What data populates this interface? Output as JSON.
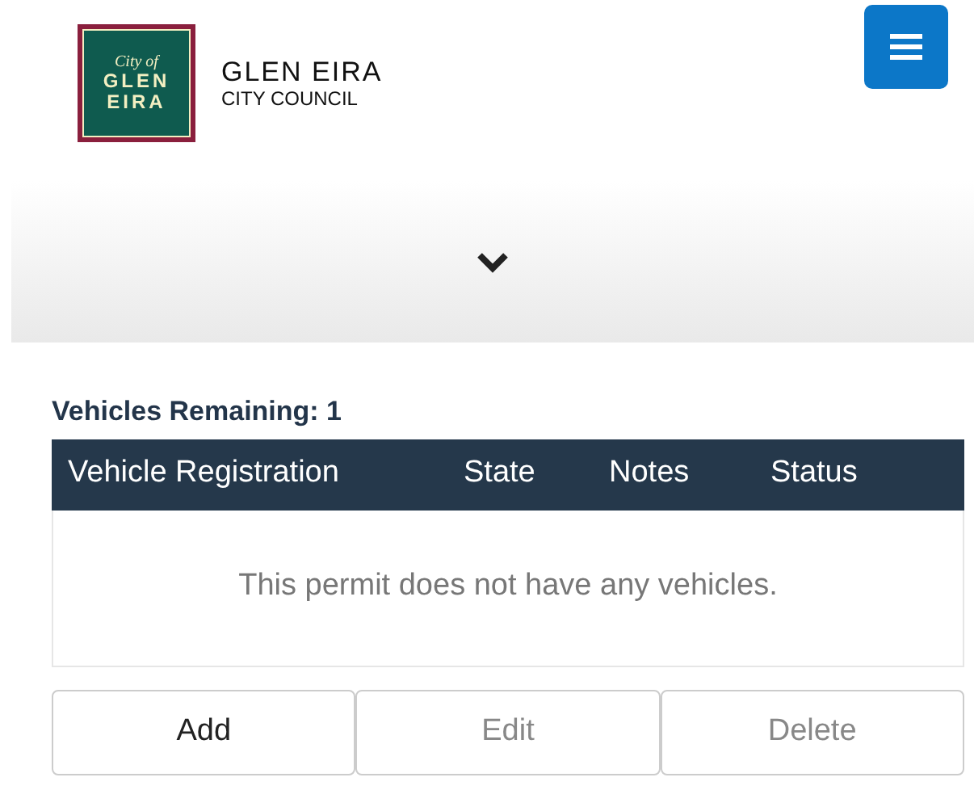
{
  "header": {
    "logo": {
      "line_1": "City of",
      "line_2": "GLEN",
      "line_3": "EIRA"
    },
    "brand_name": "GLEN EIRA",
    "brand_sub": "CITY COUNCIL"
  },
  "banner": {
    "expanded": false
  },
  "vehicles": {
    "heading": "Vehicles Remaining: 1",
    "table": {
      "columns": [
        "Vehicle Registration",
        "State",
        "Notes",
        "Status"
      ],
      "empty_message": "This permit does not have any vehicles."
    },
    "buttons": [
      {
        "label": "Add",
        "disabled": false
      },
      {
        "label": "Edit",
        "disabled": true
      },
      {
        "label": "Delete",
        "disabled": true
      }
    ]
  }
}
